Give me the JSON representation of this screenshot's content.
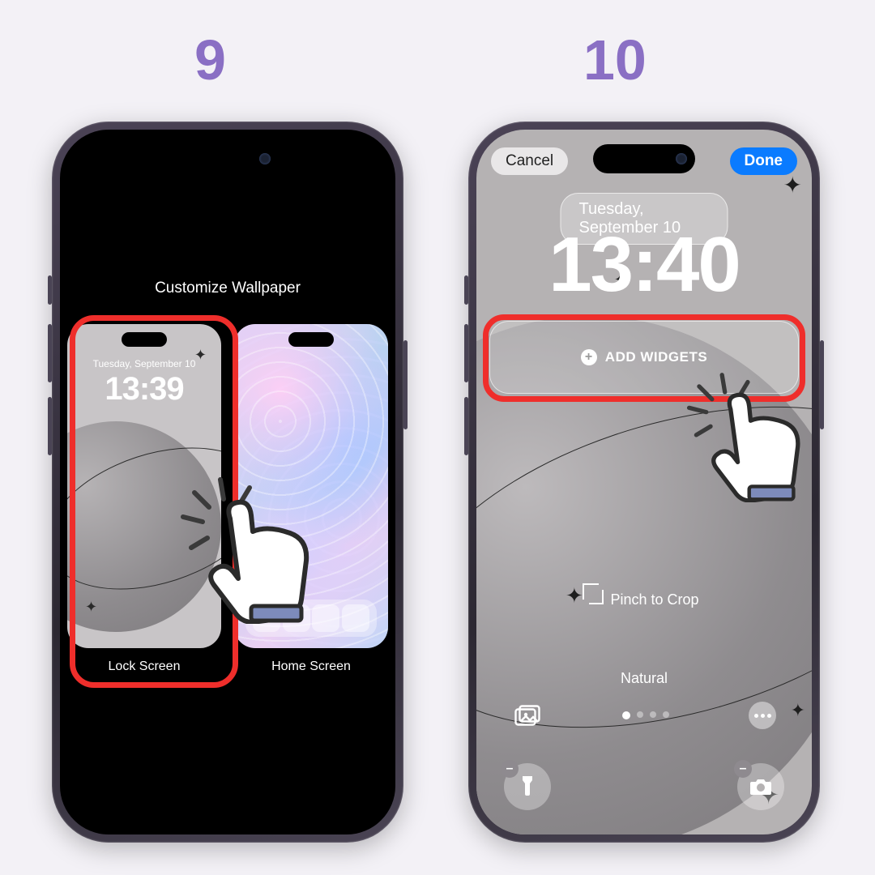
{
  "steps": {
    "nine": "9",
    "ten": "10"
  },
  "step9": {
    "title": "Customize Wallpaper",
    "lock_label": "Lock Screen",
    "home_label": "Home Screen",
    "thumb_date": "Tuesday, September 10",
    "thumb_time": "13:39"
  },
  "step10": {
    "cancel": "Cancel",
    "done": "Done",
    "date": "Tuesday, September 10",
    "time": "13:40",
    "add_widgets": "ADD WIDGETS",
    "pinch": "Pinch to Crop",
    "filter": "Natural"
  },
  "colors": {
    "highlight": "#ef2e2b",
    "step_number": "#8a6fc4",
    "done_blue": "#0a7bff"
  }
}
